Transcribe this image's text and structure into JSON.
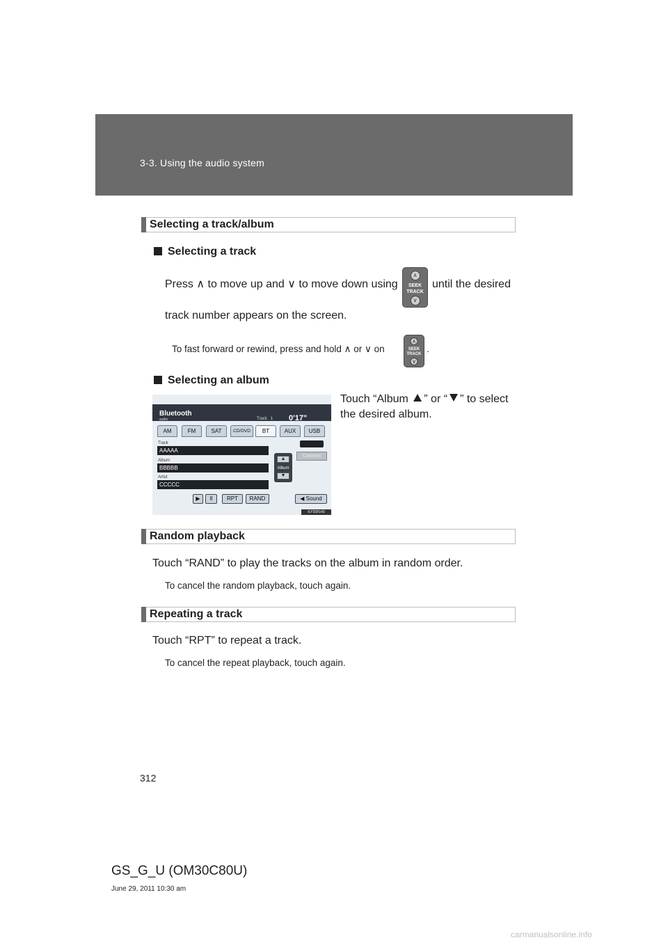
{
  "header": {
    "section": "3-3. Using the audio system"
  },
  "sections": [
    {
      "title": "Selecting a track/album"
    },
    {
      "title": "Random playback"
    },
    {
      "title": "Repeating a track"
    }
  ],
  "selecting_track": {
    "heading": "Selecting a track",
    "line1_a": "Press ∧ to move up and ∨ to move down using",
    "line1_b": "until the desired",
    "line2": "track number appears on the screen.",
    "note_a": "To fast forward or rewind, press and hold ∧ or ∨ on",
    "note_b": "."
  },
  "seek_button": {
    "line1": "SEEK",
    "line2": "TRACK",
    "up": "∧",
    "down": "∨"
  },
  "selecting_album": {
    "heading": "Selecting an album",
    "line1_a": "Touch “Album",
    "line1_b": "” or “",
    "line1_c": "” to select",
    "line2": "the desired album."
  },
  "screen": {
    "title": "Bluetooth",
    "subtitle": "audio",
    "track_label": "Track",
    "track_no": "1",
    "time": "0'17\"",
    "tabs": [
      "AM",
      "FM",
      "SAT",
      "CD/DVD",
      "BT",
      "AUX",
      "USB"
    ],
    "active_tab": "BT",
    "fields": [
      {
        "label": "Track",
        "value": "AAAAA"
      },
      {
        "label": "Album",
        "value": "BBBBB"
      },
      {
        "label": "Artist",
        "value": "CCCCC"
      }
    ],
    "album_label": "Album",
    "connect": "Connect",
    "controls": [
      "▶",
      "II",
      "RPT",
      "RAND"
    ],
    "sound": "◀ Sound",
    "code": "ILY33X143"
  },
  "random": {
    "text": "Touch “RAND” to play the tracks on the album in random order.",
    "note": "To cancel the random playback, touch again."
  },
  "repeat": {
    "text": "Touch “RPT” to repeat a track.",
    "note": "To cancel the repeat playback, touch again."
  },
  "footer": {
    "page": "312",
    "doc_id": "GS_G_U (OM30C80U)",
    "date": "June 29, 2011 10:30 am",
    "watermark": "carmanualsonline.info"
  }
}
